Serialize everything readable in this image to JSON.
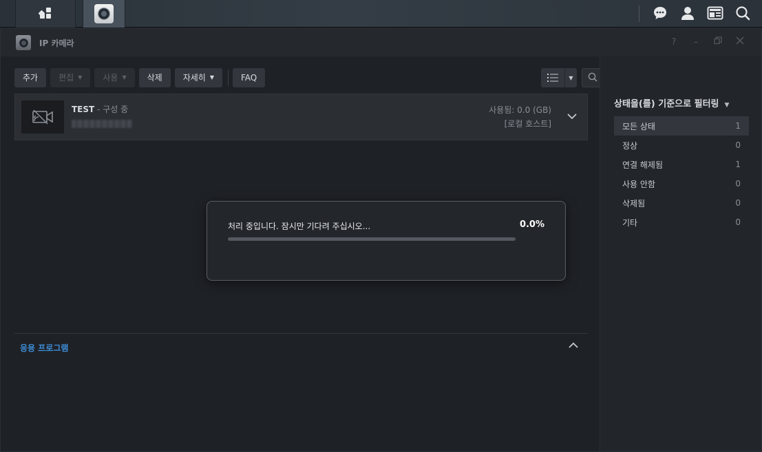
{
  "window": {
    "title": "IP 카메라"
  },
  "toolbar": {
    "add": "추가",
    "edit": "편집",
    "enable": "사용",
    "delete": "삭제",
    "details": "자세히",
    "faq": "FAQ"
  },
  "search": {
    "placeholder": "검색",
    "value": ""
  },
  "camera": {
    "name": "TEST",
    "status": " - 구성 중",
    "usage": "사용됨: 0.0 (GB)",
    "host": "[로컬 호스트]"
  },
  "dialog": {
    "message": "처리 중입니다. 잠시만 기다려 주십시오...",
    "percent_label": "0.0%",
    "progress_fraction": 0.0
  },
  "apps": {
    "title": "응용 프로그램"
  },
  "filter": {
    "title": "상태을(를) 기준으로 필터링",
    "items": [
      {
        "label": "모든 상태",
        "count": "1"
      },
      {
        "label": "정상",
        "count": "0"
      },
      {
        "label": "연결 해제됨",
        "count": "1"
      },
      {
        "label": "사용 안함",
        "count": "0"
      },
      {
        "label": "삭제됨",
        "count": "0"
      },
      {
        "label": "기타",
        "count": "0"
      }
    ]
  },
  "colors": {
    "accent": "#3d8ed8",
    "panel_toggle": "#2f4a63",
    "background": "#1e2126"
  },
  "icons": {
    "taskbar_main": "grid-icon",
    "taskbar_app": "ip-camera-icon",
    "chat": "chat-icon",
    "user": "user-icon",
    "widgets": "widgets-icon",
    "search": "search-icon"
  }
}
